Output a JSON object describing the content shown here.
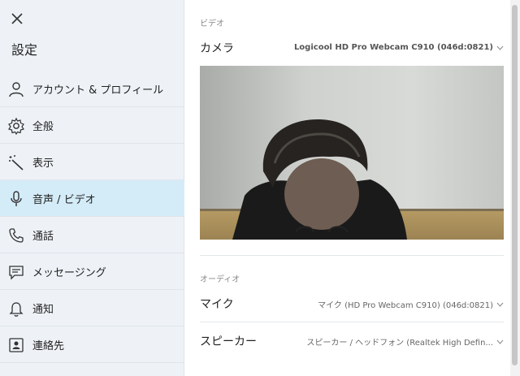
{
  "sidebar": {
    "title": "設定",
    "items": [
      {
        "label": "アカウント & プロフィール",
        "icon": "person-icon"
      },
      {
        "label": "全般",
        "icon": "gear-icon"
      },
      {
        "label": "表示",
        "icon": "magic-wand-icon"
      },
      {
        "label": "音声 / ビデオ",
        "icon": "microphone-icon",
        "active": true
      },
      {
        "label": "通話",
        "icon": "phone-icon"
      },
      {
        "label": "メッセージング",
        "icon": "chat-icon"
      },
      {
        "label": "通知",
        "icon": "bell-icon"
      },
      {
        "label": "連絡先",
        "icon": "contact-card-icon"
      }
    ]
  },
  "main": {
    "video_section": "ビデオ",
    "camera_label": "カメラ",
    "camera_value": "Logicool HD Pro Webcam C910 (046d:0821)",
    "audio_section": "オーディオ",
    "mic_label": "マイク",
    "mic_value": "マイク (HD Pro Webcam C910) (046d:0821)",
    "speaker_label": "スピーカー",
    "speaker_value": "スピーカー / ヘッドフォン (Realtek High Defin..."
  },
  "colors": {
    "sidebar_bg": "#eef2f7",
    "active_bg": "#d4ecf8"
  }
}
